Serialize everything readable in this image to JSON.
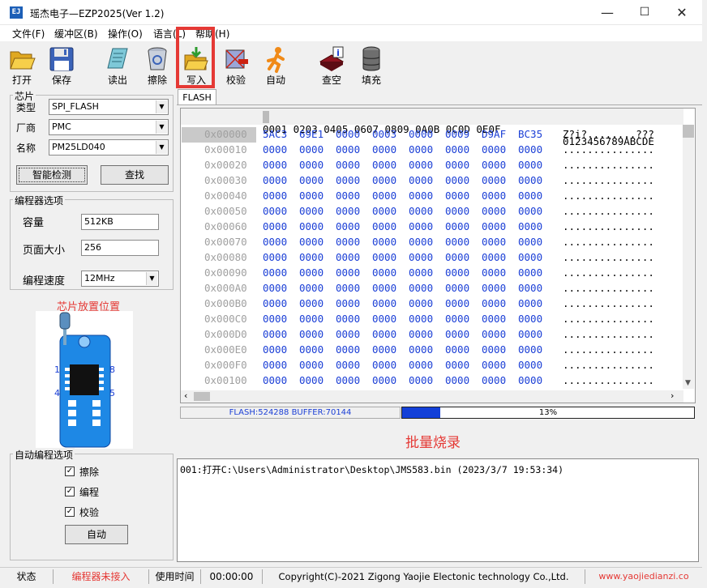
{
  "window": {
    "title": "瑶杰电子—EZP2025(Ver 1.2)",
    "app_icon_text": "EJ",
    "minimize_glyph": "—",
    "maximize_glyph": "☐",
    "close_glyph": "✕"
  },
  "menu": [
    "文件(F)",
    "缓冲区(B)",
    "操作(O)",
    "语言(L)",
    "帮助(H)"
  ],
  "toolbar": [
    {
      "label": "打开",
      "icon": "folder-open-icon"
    },
    {
      "label": "保存",
      "icon": "floppy-disk-icon"
    },
    {
      "label": "读出",
      "icon": "read-chip-icon"
    },
    {
      "label": "擦除",
      "icon": "trash-can-icon"
    },
    {
      "label": "写入",
      "icon": "write-folder-icon"
    },
    {
      "label": "校验",
      "icon": "verify-chip-icon"
    },
    {
      "label": "自动",
      "icon": "running-man-icon"
    },
    {
      "label": "查空",
      "icon": "blank-check-icon"
    },
    {
      "label": "填充",
      "icon": "fill-barrel-icon"
    }
  ],
  "chip": {
    "group_label": "芯片",
    "type_label": "类型",
    "type_value": "SPI_FLASH",
    "vendor_label": "厂商",
    "vendor_value": "PMC",
    "name_label": "名称",
    "name_value": "PM25LD040",
    "detect_button": "智能检测",
    "search_button": "查找"
  },
  "programmer": {
    "group_label": "编程器选项",
    "capacity_label": "容量",
    "capacity_value": "512KB",
    "page_label": "页面大小",
    "page_value": "256",
    "speed_label": "编程速度",
    "speed_value": "12MHz"
  },
  "placement": {
    "title": "芯片放置位置",
    "pin1": "1",
    "pin8": "8",
    "pin4": "4",
    "pin5": "5"
  },
  "auto": {
    "group_label": "自动编程选项",
    "erase_label": "擦除",
    "program_label": "编程",
    "verify_label": "校验",
    "auto_button": "自动",
    "check_glyph": "✓"
  },
  "tab": "FLASH",
  "hex": {
    "column_header": "0001 0203 0405 0607 0809 0A0B 0C0D 0E0F",
    "ascii_header": "0123456789ABCDE",
    "rows": [
      {
        "addr": "0x00000",
        "vals": [
          "5AC3",
          "69E1",
          "0000",
          "0003",
          "0000",
          "0009",
          "D9AF",
          "BC35"
        ],
        "ascii": "Z?i?........???"
      },
      {
        "addr": "0x00010",
        "vals": [
          "0000",
          "0000",
          "0000",
          "0000",
          "0000",
          "0000",
          "0000",
          "0000"
        ],
        "ascii": "..............."
      },
      {
        "addr": "0x00020",
        "vals": [
          "0000",
          "0000",
          "0000",
          "0000",
          "0000",
          "0000",
          "0000",
          "0000"
        ],
        "ascii": "..............."
      },
      {
        "addr": "0x00030",
        "vals": [
          "0000",
          "0000",
          "0000",
          "0000",
          "0000",
          "0000",
          "0000",
          "0000"
        ],
        "ascii": "..............."
      },
      {
        "addr": "0x00040",
        "vals": [
          "0000",
          "0000",
          "0000",
          "0000",
          "0000",
          "0000",
          "0000",
          "0000"
        ],
        "ascii": "..............."
      },
      {
        "addr": "0x00050",
        "vals": [
          "0000",
          "0000",
          "0000",
          "0000",
          "0000",
          "0000",
          "0000",
          "0000"
        ],
        "ascii": "..............."
      },
      {
        "addr": "0x00060",
        "vals": [
          "0000",
          "0000",
          "0000",
          "0000",
          "0000",
          "0000",
          "0000",
          "0000"
        ],
        "ascii": "..............."
      },
      {
        "addr": "0x00070",
        "vals": [
          "0000",
          "0000",
          "0000",
          "0000",
          "0000",
          "0000",
          "0000",
          "0000"
        ],
        "ascii": "..............."
      },
      {
        "addr": "0x00080",
        "vals": [
          "0000",
          "0000",
          "0000",
          "0000",
          "0000",
          "0000",
          "0000",
          "0000"
        ],
        "ascii": "..............."
      },
      {
        "addr": "0x00090",
        "vals": [
          "0000",
          "0000",
          "0000",
          "0000",
          "0000",
          "0000",
          "0000",
          "0000"
        ],
        "ascii": "..............."
      },
      {
        "addr": "0x000A0",
        "vals": [
          "0000",
          "0000",
          "0000",
          "0000",
          "0000",
          "0000",
          "0000",
          "0000"
        ],
        "ascii": "..............."
      },
      {
        "addr": "0x000B0",
        "vals": [
          "0000",
          "0000",
          "0000",
          "0000",
          "0000",
          "0000",
          "0000",
          "0000"
        ],
        "ascii": "..............."
      },
      {
        "addr": "0x000C0",
        "vals": [
          "0000",
          "0000",
          "0000",
          "0000",
          "0000",
          "0000",
          "0000",
          "0000"
        ],
        "ascii": "..............."
      },
      {
        "addr": "0x000D0",
        "vals": [
          "0000",
          "0000",
          "0000",
          "0000",
          "0000",
          "0000",
          "0000",
          "0000"
        ],
        "ascii": "..............."
      },
      {
        "addr": "0x000E0",
        "vals": [
          "0000",
          "0000",
          "0000",
          "0000",
          "0000",
          "0000",
          "0000",
          "0000"
        ],
        "ascii": "..............."
      },
      {
        "addr": "0x000F0",
        "vals": [
          "0000",
          "0000",
          "0000",
          "0000",
          "0000",
          "0000",
          "0000",
          "0000"
        ],
        "ascii": "..............."
      },
      {
        "addr": "0x00100",
        "vals": [
          "0000",
          "0000",
          "0000",
          "0000",
          "0000",
          "0000",
          "0000",
          "0000"
        ],
        "ascii": "..............."
      }
    ]
  },
  "progress": {
    "info": "FLASH:524288 BUFFER:70144",
    "percent_label": "13%",
    "fraction": 0.13,
    "bar_color": "#1340d8"
  },
  "batch_label": "批量烧录",
  "log": "001:打开C:\\Users\\Administrator\\Desktop\\JMS583.bin (2023/3/7 19:53:34)",
  "status": {
    "state_label": "状态",
    "state_value": "编程器未接入",
    "time_label": "使用时间",
    "time_value": "00:00:00",
    "copyright": "Copyright(C)-2021 Zigong Yaojie Electonic technology Co.,Ltd.",
    "website": "www.yaojiedianzi.co"
  },
  "colors": {
    "accent_red": "#e53935",
    "hex_blue": "#1b3fd6",
    "board_blue": "#1e88e5"
  }
}
